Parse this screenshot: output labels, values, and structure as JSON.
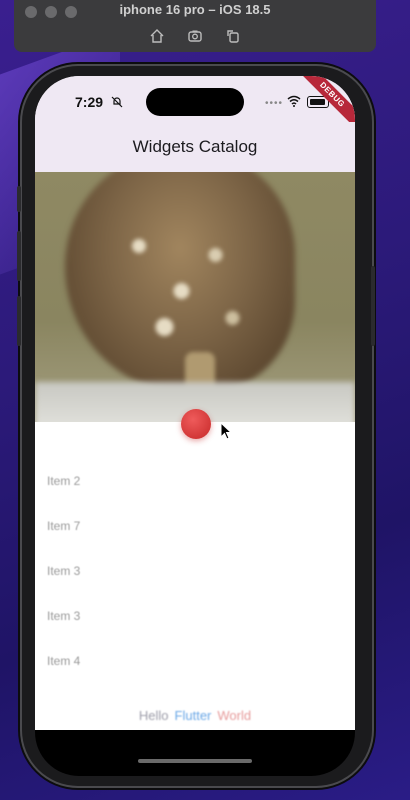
{
  "simulator": {
    "title": "iphone 16 pro – iOS 18.5",
    "icons": [
      "home-icon",
      "screenshot-icon",
      "rotate-icon"
    ]
  },
  "status_bar": {
    "time": "7:29",
    "debug_banner": "DEBUG"
  },
  "app_bar": {
    "title": "Widgets Catalog"
  },
  "list": {
    "items": [
      "Item 2",
      "Item 7",
      "Item 3",
      "Item 3",
      "Item 4"
    ]
  },
  "bottom": {
    "labels": [
      "Hello",
      "Flutter",
      "World"
    ]
  },
  "colors": {
    "app_bar_bg": "#efe8f3",
    "fab": "#c62828",
    "debug": "#b7283a"
  }
}
